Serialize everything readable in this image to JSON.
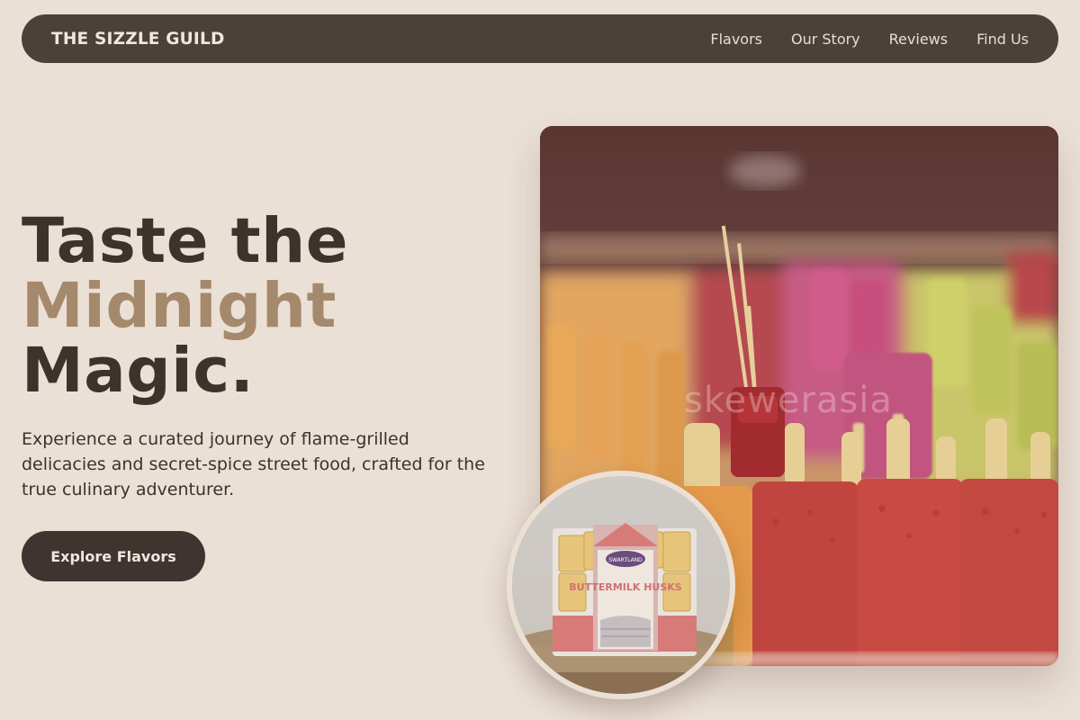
{
  "nav": {
    "brand": "THE SIZZLE GUILD",
    "links": [
      "Flavors",
      "Our Story",
      "Reviews",
      "Find Us"
    ]
  },
  "hero": {
    "title_line1": "Taste the",
    "title_line2": "Midnight",
    "title_line3": "Magic.",
    "description": "Experience a curated journey of flame-grilled delicacies and secret-spice street food, crafted for the true culinary adventurer.",
    "cta_label": "Explore Flavors"
  },
  "main_image": {
    "subject": "rows of colorful popsicles in a display case",
    "watermark": "skewerasia"
  },
  "circle_image": {
    "subject": "package of Swartland Buttermilk Husks on a woven mat",
    "brand": "SWARTLAND",
    "product": "BUTTERMILK HUSKS"
  },
  "colors": {
    "background": "#ebe0d6",
    "nav_bg": "#4c403b",
    "text_dark": "#3d322c",
    "accent": "#a4896c",
    "button_bg": "#3f342f"
  }
}
